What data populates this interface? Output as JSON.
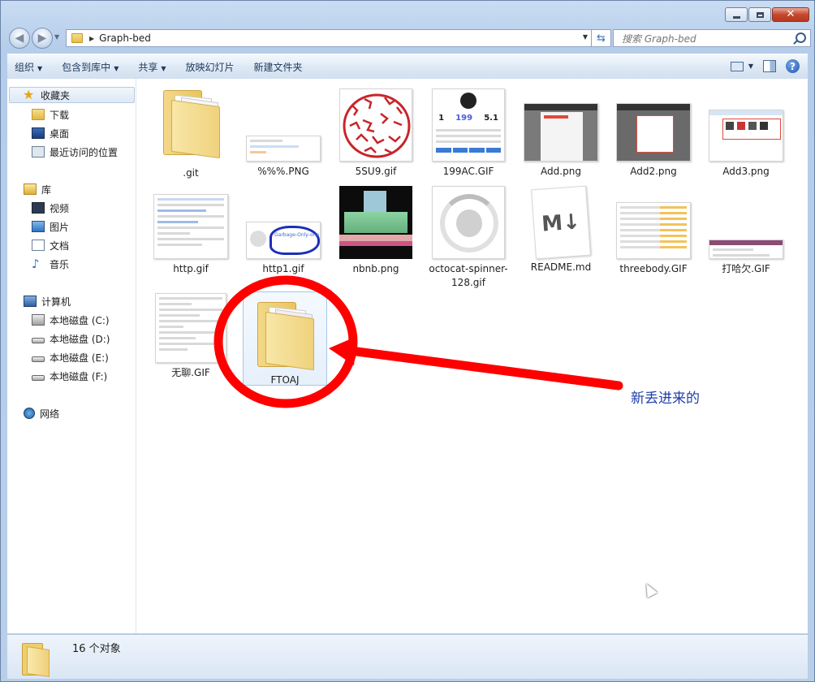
{
  "window": {
    "address_path": "Graph-bed",
    "search_placeholder": "搜索 Graph-bed",
    "caption": {
      "minimize": "minimize",
      "maximize": "maximize",
      "close": "✕"
    }
  },
  "toolbar": {
    "organize": "组织",
    "include_in_library": "包含到库中",
    "share": "共享",
    "slideshow": "放映幻灯片",
    "new_folder": "新建文件夹"
  },
  "nav": {
    "favorites": "收藏夹",
    "downloads": "下载",
    "desktop": "桌面",
    "recent": "最近访问的位置",
    "libraries": "库",
    "videos": "视频",
    "pictures": "图片",
    "documents": "文档",
    "music": "音乐",
    "computer": "计算机",
    "disk_c": "本地磁盘 (C:)",
    "disk_d": "本地磁盘 (D:)",
    "disk_e": "本地磁盘 (E:)",
    "disk_f": "本地磁盘 (F:)",
    "network": "网络"
  },
  "files": [
    {
      "name": ".git"
    },
    {
      "name": "%%%.PNG"
    },
    {
      "name": "5SU9.gif"
    },
    {
      "name": "199AC.GIF"
    },
    {
      "name": "Add.png"
    },
    {
      "name": "Add2.png"
    },
    {
      "name": "Add3.png"
    },
    {
      "name": "http.gif"
    },
    {
      "name": "http1.gif"
    },
    {
      "name": "nbnb.png"
    },
    {
      "name": "octocat-spinner-128.gif"
    },
    {
      "name": "README.md"
    },
    {
      "name": "threebody.GIF"
    },
    {
      "name": "打哈欠.GIF"
    },
    {
      "name": "无聊.GIF"
    },
    {
      "name": "FTOAJ"
    }
  ],
  "thumb_text": {
    "stat_1": "1",
    "stat_199": "199",
    "stat_5": "5.1",
    "markdown": "M↓",
    "garbage": "Garbage-Only-one"
  },
  "annotation": {
    "text": "新丢进来的",
    "color": "#ff0000"
  },
  "status": {
    "count": "16 个对象"
  }
}
